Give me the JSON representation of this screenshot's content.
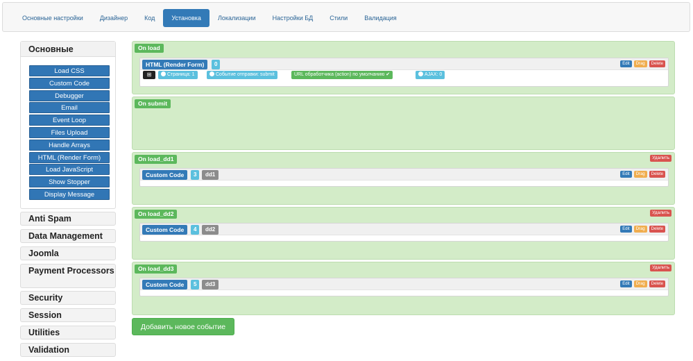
{
  "tabs": [
    {
      "label": "Основные настройки"
    },
    {
      "label": "Дизайнер"
    },
    {
      "label": "Код"
    },
    {
      "label": "Установка",
      "active": true
    },
    {
      "label": "Локализации"
    },
    {
      "label": "Настройки БД"
    },
    {
      "label": "Стили"
    },
    {
      "label": "Валидация"
    }
  ],
  "sidebar": {
    "main_title": "Основные",
    "main_items": [
      "Load CSS",
      "Custom Code",
      "Debugger",
      "Email",
      "Event Loop",
      "Files Upload",
      "Handle Arrays",
      "HTML (Render Form)",
      "Load JavaScript",
      "Show Stopper",
      "Display Message"
    ],
    "groups": [
      "Anti Spam",
      "Data Management",
      "Joomla",
      "Payment Processors",
      "Security",
      "Session",
      "Utilities",
      "Validation"
    ]
  },
  "events": {
    "onload": {
      "label": "On load",
      "action": {
        "title": "HTML (Render Form)",
        "number": "0",
        "settings": {
          "dark_icon": "sitemap-icon",
          "page": "Страница: 1",
          "submit_event": "Событие отправки: submit",
          "url_action": "URL обработчика (action) по умолчанию",
          "ajax": "AJAX: 0"
        }
      }
    },
    "onsubmit": {
      "label": "On submit"
    },
    "dd1": {
      "label": "On load_dd1",
      "delete": "Удалить",
      "action": {
        "title": "Custom Code",
        "number": "3",
        "tag": "dd1"
      }
    },
    "dd2": {
      "label": "On load_dd2",
      "delete": "Удалить",
      "action": {
        "title": "Custom Code",
        "number": "4",
        "tag": "dd2"
      }
    },
    "dd3": {
      "label": "On load_dd3",
      "delete": "Удалить",
      "action": {
        "title": "Custom Code",
        "number": "5",
        "tag": "dd3"
      }
    }
  },
  "action_buttons": {
    "edit": "Edit",
    "drag": "Drag",
    "delete": "Delete"
  },
  "add_event_label": "Добавить новое событие",
  "colors": {
    "primary": "#337ab7",
    "success": "#5cb85c",
    "info": "#5bc0de",
    "warning": "#f0ad4e",
    "danger": "#d9534f",
    "event_bg": "#d3ecc8"
  }
}
